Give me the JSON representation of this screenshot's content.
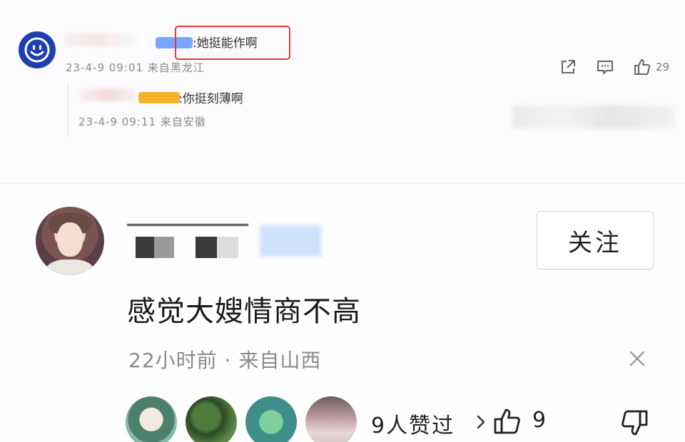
{
  "reply_thread": {
    "top_comment": {
      "text": ":她挺能作啊",
      "time_location": "23-4-9 09:01 来自黑龙江",
      "like_count": "29"
    },
    "reply": {
      "text": ":你挺刻薄啊",
      "time_location": "23-4-9 09:11 来自安徽"
    }
  },
  "main_comment": {
    "follow_label": "关注",
    "text": "感觉大嫂情商不高",
    "meta": "22小时前 · 来自山西",
    "likers_summary": "9人赞过",
    "like_count": "9"
  },
  "colors": {
    "highlight_box": "#e0393e",
    "avatar_blue": "#1e3fb0",
    "badge_blue": "#7aa6ff",
    "badge_gold": "#f5b22a"
  },
  "icons": {
    "share": "share-icon",
    "comment": "comment-icon",
    "like": "thumb-up-icon",
    "dislike": "thumb-down-icon",
    "close": "close-icon",
    "chevron": "chevron-right-icon"
  }
}
